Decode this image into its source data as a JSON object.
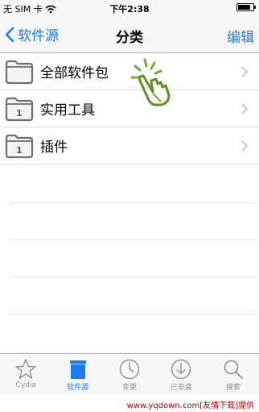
{
  "status_bar": {
    "carrier": "无 SIM 卡",
    "time": "下午2:38",
    "wifi_icon": "wifi-icon",
    "battery_icon": "battery-icon",
    "battery_level": 0.85
  },
  "nav": {
    "back_label": "软件源",
    "title": "分类",
    "edit_label": "编辑",
    "accent_color": "#1a7cf5"
  },
  "list": {
    "items": [
      {
        "label": "全部软件包",
        "icon": "folder-icon",
        "badge": ""
      },
      {
        "label": "实用工具",
        "icon": "folder-icon",
        "badge": "1"
      },
      {
        "label": "插件",
        "icon": "folder-icon",
        "badge": "1"
      }
    ]
  },
  "tabs": [
    {
      "label": "Cydia",
      "icon": "star-icon",
      "active": false
    },
    {
      "label": "软件源",
      "icon": "sources-icon",
      "active": true
    },
    {
      "label": "变更",
      "icon": "clock-icon",
      "active": false
    },
    {
      "label": "已安装",
      "icon": "download-icon",
      "active": false
    },
    {
      "label": "搜索",
      "icon": "magnifier-icon",
      "active": false
    }
  ],
  "footer": {
    "watermark": "www.yqdown.com[友情下载]提供",
    "color": "#cc0000"
  }
}
